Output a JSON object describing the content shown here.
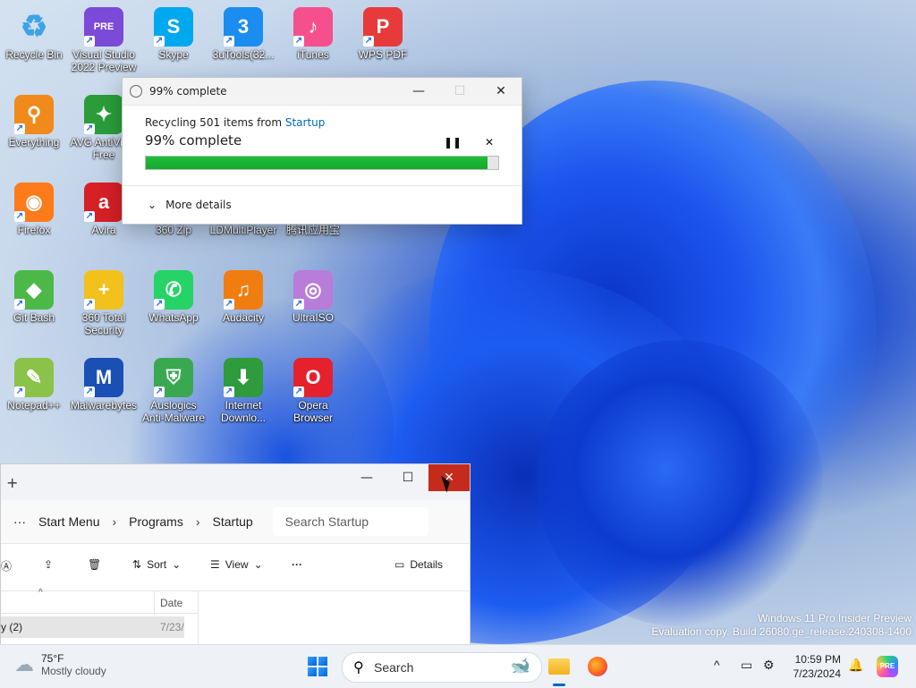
{
  "desktop": {
    "icons": [
      {
        "label": "Recycle Bin",
        "glyph": "♻",
        "color": "#ffffff"
      },
      {
        "label": "Visual Studio 2022 Preview",
        "glyph": "PRE",
        "color": "#7b4ad8"
      },
      {
        "label": "Skype",
        "glyph": "S",
        "color": "#00a8f0"
      },
      {
        "label": "3uTools(32...",
        "glyph": "3",
        "color": "#1b8df0"
      },
      {
        "label": "iTunes",
        "glyph": "♪",
        "color": "#f54f8c"
      },
      {
        "label": "WPS PDF",
        "glyph": "P",
        "color": "#e73a3a"
      },
      {
        "label": "Everything",
        "glyph": "⚲",
        "color": "#f08a1b"
      },
      {
        "label": "AVG AntiVirus Free",
        "glyph": "✦",
        "color": "#2a9d3a"
      },
      {
        "label": "Firefox",
        "glyph": "◉",
        "color": "#ff7a1a"
      },
      {
        "label": "Avira",
        "glyph": "a",
        "color": "#d71f26"
      },
      {
        "label": "360 Zip",
        "glyph": "",
        "color": "#1f6ee0"
      },
      {
        "label": "LDMultiPlayer",
        "glyph": "",
        "color": "#2d6fe0"
      },
      {
        "label": "腾讯应用宝",
        "glyph": "",
        "color": "#2d6fe0"
      },
      {
        "label": "Git Bash",
        "glyph": "◆",
        "color": "#4cb848"
      },
      {
        "label": "360 Total Security",
        "glyph": "+",
        "color": "#f2c11b"
      },
      {
        "label": "WhatsApp",
        "glyph": "✆",
        "color": "#25d366"
      },
      {
        "label": "Audacity",
        "glyph": "♫",
        "color": "#f07d10"
      },
      {
        "label": "UltraISO",
        "glyph": "◎",
        "color": "#b87cd9"
      },
      {
        "label": "Notepad++",
        "glyph": "✎",
        "color": "#8bc34a"
      },
      {
        "label": "Malwarebytes",
        "glyph": "M",
        "color": "#1a4fb6"
      },
      {
        "label": "Auslogics Anti-Malware",
        "glyph": "⛨",
        "color": "#3aa850"
      },
      {
        "label": "Internet Downlo...",
        "glyph": "⬇",
        "color": "#2e9b3c"
      },
      {
        "label": "Opera Browser",
        "glyph": "O",
        "color": "#e4212d"
      }
    ]
  },
  "dialog": {
    "title": "99% complete",
    "recycling_prefix": "Recycling 501 items from ",
    "recycling_link": "Startup",
    "status": "99% complete",
    "progress": 0.97,
    "pause_icon": "pause-icon",
    "more_details": "More details"
  },
  "explorer": {
    "breadcrumb": [
      "Start Menu",
      "Programs",
      "Startup"
    ],
    "search_placeholder": "Search Startup",
    "toolbar": {
      "sort": "Sort",
      "view": "View",
      "details": "Details"
    },
    "columns": {
      "date": "Date"
    },
    "row": {
      "name": "y (2)",
      "date": "7/23/"
    }
  },
  "watermark": {
    "line1": "Windows 11 Pro Insider Preview",
    "line2": "Evaluation copy. Build 26080.ge_release.240308-1400"
  },
  "taskbar": {
    "weather_temp": "75°F",
    "weather_desc": "Mostly cloudy",
    "search": "Search",
    "time": "10:59 PM",
    "date": "7/23/2024"
  }
}
